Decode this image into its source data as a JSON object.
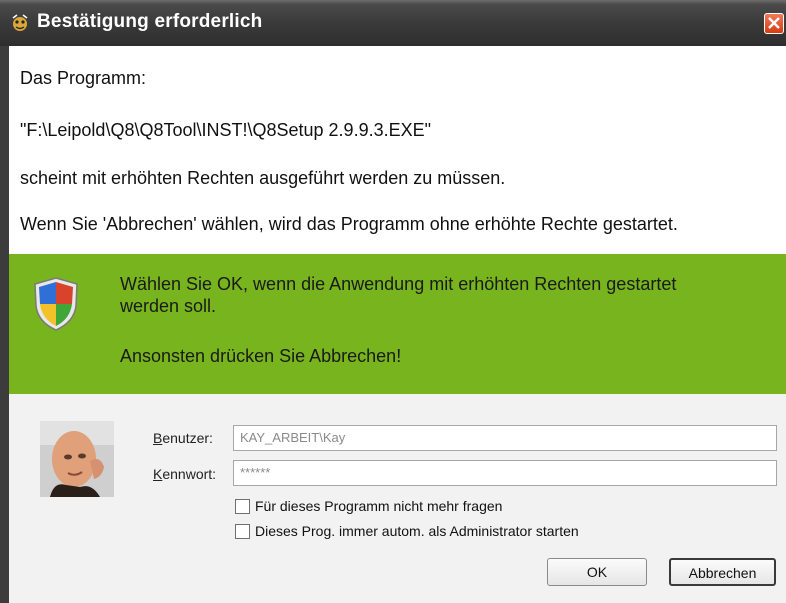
{
  "window": {
    "title": "Bestätigung erforderlich",
    "close_label": "close"
  },
  "message": {
    "line1": "Das Programm:",
    "line2": "\"F:\\Leipold\\Q8\\Q8Tool\\INST!\\Q8Setup 2.9.9.3.EXE\"",
    "line3": "scheint mit erhöhten Rechten ausgeführt werden zu müssen.",
    "line4": "Wenn Sie  'Abbrechen' wählen, wird das Programm ohne erhöhte Rechte gestartet."
  },
  "banner": {
    "color": "#77b41e",
    "text1a": "Wählen Sie OK, wenn die Anwendung mit erhöhten Rechten gestartet",
    "text1b": "werden soll.",
    "text2": "Ansonsten drücken Sie Abbrechen!",
    "icon": "shield-icon"
  },
  "credentials": {
    "user_label_u": "B",
    "user_label_rest": "enutzer:",
    "user_value": "KAY_ARBEIT\\Kay",
    "pass_label_u": "K",
    "pass_label_rest": "ennwort:",
    "pass_value": "******"
  },
  "options": {
    "checkbox1_label": "Für dieses Programm nicht mehr fragen",
    "checkbox1_checked": false,
    "checkbox2_label": "Dieses Prog. immer autom. als Administrator starten",
    "checkbox2_checked": false
  },
  "buttons": {
    "ok_label": "OK",
    "cancel_label": "Abbrechen"
  }
}
